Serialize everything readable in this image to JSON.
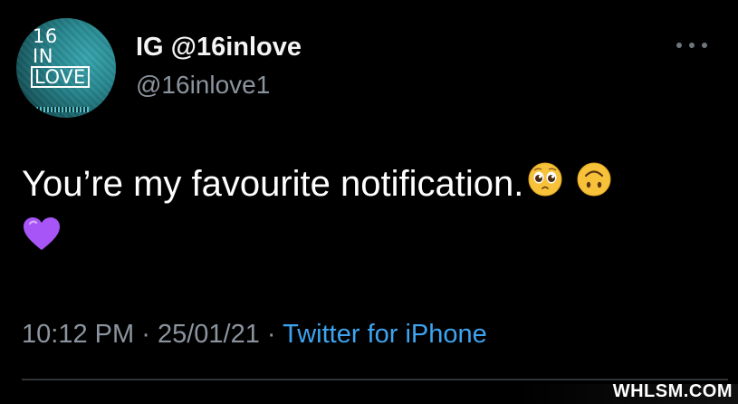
{
  "tweet": {
    "display_name": "IG @16inlove",
    "handle": "@16inlove1",
    "avatar": {
      "line1": "16",
      "line2": "IN",
      "line3": "LOVE"
    },
    "text": "You’re my favourite notification.",
    "emojis": [
      "pleading-face-emoji",
      "upside-down-face-emoji",
      "purple-heart-emoji"
    ],
    "time": "10:12 PM",
    "date": "25/01/21",
    "separator": "·",
    "source": "Twitter for iPhone"
  },
  "watermark": "WHLSM.COM",
  "colors": {
    "background": "#000000",
    "text": "#ffffff",
    "muted": "#8b949e",
    "link": "#3ea4f0",
    "purple": "#a855f7"
  }
}
